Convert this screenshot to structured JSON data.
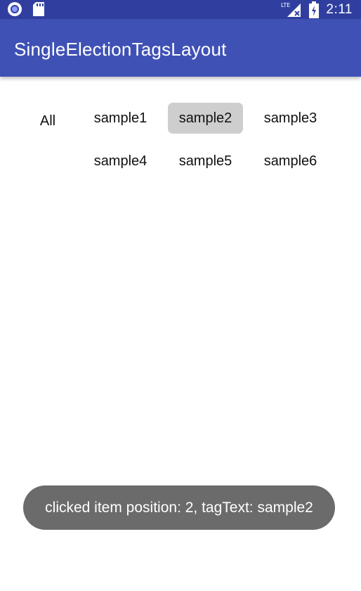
{
  "status_bar": {
    "time": "2:11",
    "network": "LTE",
    "icons": [
      "app-circle-icon",
      "sd-card-icon",
      "lte-signal-icon",
      "battery-icon"
    ]
  },
  "app_bar": {
    "title": "SingleElectionTagsLayout"
  },
  "tags": {
    "all_label": "All",
    "items": [
      "sample1",
      "sample2",
      "sample3",
      "sample4",
      "sample5",
      "sample6"
    ],
    "selected": "sample2"
  },
  "toast": {
    "message": "clicked item position: 2, tagText: sample2"
  },
  "colors": {
    "status_bar": "#303f9f",
    "app_bar": "#3f51b5",
    "selected_tag": "#cecece",
    "toast": "#6b6b6b"
  }
}
